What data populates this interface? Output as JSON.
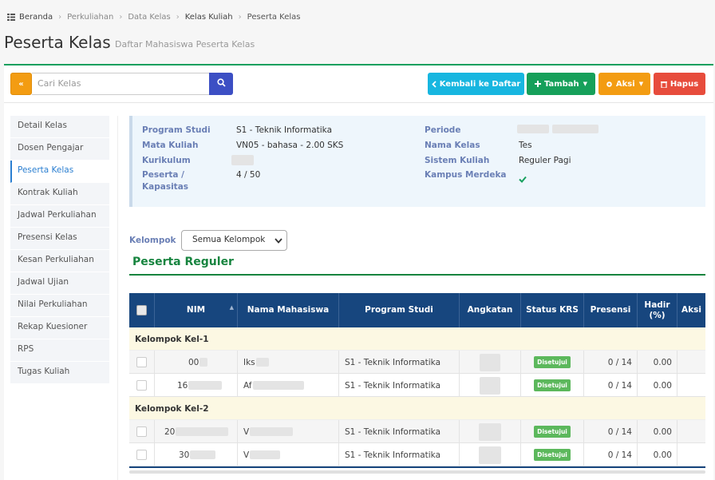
{
  "breadcrumb": [
    "Beranda",
    "Perkuliahan",
    "Data Kelas",
    "Kelas Kuliah",
    "Peserta Kelas"
  ],
  "page": {
    "title": "Peserta Kelas",
    "subtitle": "Daftar Mahasiswa Peserta Kelas"
  },
  "toolbar": {
    "search_placeholder": "Cari Kelas",
    "back_icon": "«",
    "kembali_label": "Kembali ke Daftar",
    "tambah_label": "Tambah",
    "aksi_label": "Aksi",
    "hapus_label": "Hapus",
    "colors": {
      "back": "#f39c12",
      "search": "#3c4fc4",
      "kembali": "#17b6e0",
      "tambah": "#16a05a",
      "aksi": "#f39c12",
      "hapus": "#e74c3c"
    }
  },
  "sidebar": {
    "items": [
      {
        "label": "Detail Kelas"
      },
      {
        "label": "Dosen Pengajar"
      },
      {
        "label": "Peserta Kelas",
        "active": true
      },
      {
        "label": "Kontrak Kuliah"
      },
      {
        "label": "Jadwal Perkuliahan"
      },
      {
        "label": "Presensi Kelas"
      },
      {
        "label": "Kesan Perkuliahan"
      },
      {
        "label": "Jadwal Ujian"
      },
      {
        "label": "Nilai Perkuliahan"
      },
      {
        "label": "Rekap Kuesioner"
      },
      {
        "label": "RPS"
      },
      {
        "label": "Tugas Kuliah"
      }
    ]
  },
  "info": {
    "program_studi_label": "Program Studi",
    "program_studi": "S1 - Teknik Informatika",
    "mata_kuliah_label": "Mata Kuliah",
    "mata_kuliah": "VN05 - bahasa - 2.00 SKS",
    "kurikulum_label": "Kurikulum",
    "peserta_label_1": "Peserta /",
    "peserta_label_2": "Kapasitas",
    "peserta": "4 / 50",
    "periode_label": "Periode",
    "nama_kelas_label": "Nama Kelas",
    "nama_kelas": "Tes",
    "sistem_kuliah_label": "Sistem Kuliah",
    "sistem_kuliah": "Reguler Pagi",
    "kampus_merdeka_label": "Kampus Merdeka",
    "kampus_merdeka_icon": "check-icon"
  },
  "filter": {
    "label": "Kelompok",
    "value": "Semua Kelompok"
  },
  "section_title": "Peserta Reguler",
  "table": {
    "headers": {
      "nim": "NIM",
      "nama": "Nama Mahasiswa",
      "prodi": "Program Studi",
      "angkatan": "Angkatan",
      "status": "Status KRS",
      "presensi": "Presensi",
      "hadir_1": "Hadir",
      "hadir_2": "(%)",
      "aksi": "Aksi"
    },
    "groups": [
      {
        "name": "Kelompok Kel-1",
        "rows": [
          {
            "nim": "00",
            "nama": "Iks",
            "prodi": "S1 - Teknik Informatika",
            "status": "Disetujui",
            "presensi": "0 / 14",
            "hadir": "0.00"
          },
          {
            "nim": "16",
            "nama": "Af",
            "prodi": "S1 - Teknik Informatika",
            "status": "Disetujui",
            "presensi": "0 / 14",
            "hadir": "0.00"
          }
        ]
      },
      {
        "name": "Kelompok Kel-2",
        "rows": [
          {
            "nim": "20",
            "nama": "V",
            "prodi": "S1 - Teknik Informatika",
            "status": "Disetujui",
            "presensi": "0 / 14",
            "hadir": "0.00"
          },
          {
            "nim": "30",
            "nama": "V",
            "prodi": "S1 - Teknik Informatika",
            "status": "Disetujui",
            "presensi": "0 / 14",
            "hadir": "0.00"
          }
        ]
      }
    ]
  }
}
